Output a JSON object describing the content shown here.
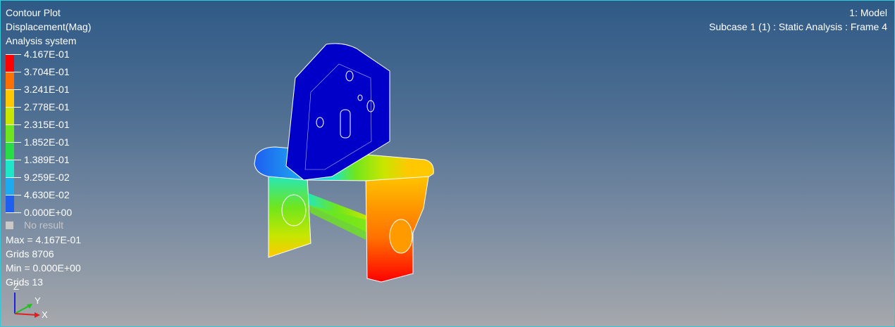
{
  "header_left": {
    "line1": "Contour Plot",
    "line2": "Displacement(Mag)",
    "line3": "Analysis system"
  },
  "header_right": {
    "model": "1: Model",
    "subcase": "Subcase 1 (1) : Static Analysis : Frame 4"
  },
  "legend": {
    "labels": [
      "4.167E-01",
      "3.704E-01",
      "3.241E-01",
      "2.778E-01",
      "2.315E-01",
      "1.852E-01",
      "1.389E-01",
      "9.259E-02",
      "4.630E-02",
      "0.000E+00"
    ],
    "band_colors": [
      "#ff0000",
      "#ff7000",
      "#ffc800",
      "#c8e600",
      "#6ee61e",
      "#28dc46",
      "#1ee6c8",
      "#1eaaf0",
      "#1e5ff0",
      "#0000c8"
    ],
    "no_result": "No result",
    "no_result_color": "#c8c8c8"
  },
  "stats": {
    "max_line": "Max = 4.167E-01",
    "max_grids": "Grids 8706",
    "min_line": "Min = 0.000E+00",
    "min_grids": "Grids 13"
  },
  "triad": {
    "y_label": "Y",
    "x_label": "X",
    "z_label": "Z",
    "x_color": "#e02020",
    "y_color": "#20c020",
    "z_color": "#2020e0"
  }
}
